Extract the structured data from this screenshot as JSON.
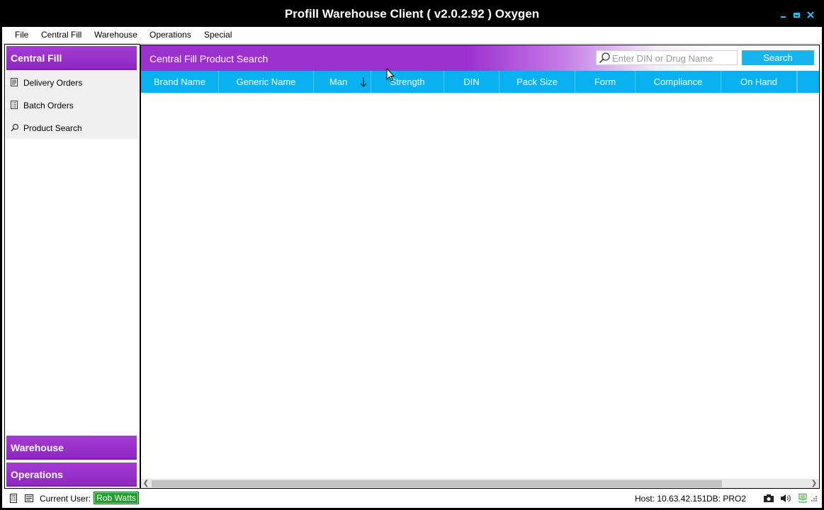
{
  "window": {
    "title": "Profill Warehouse Client ( v2.0.2.92 ) Oxygen",
    "controls": [
      "minimize-icon",
      "maximize-icon",
      "close-icon"
    ],
    "accent": "#1ec8ff"
  },
  "menubar": {
    "items": [
      "File",
      "Central Fill",
      "Warehouse",
      "Operations",
      "Special"
    ]
  },
  "sidebar": {
    "header": "Central Fill",
    "items": [
      {
        "label": "Delivery Orders",
        "icon": "document-icon"
      },
      {
        "label": "Batch Orders",
        "icon": "list-document-icon"
      },
      {
        "label": "Product Search",
        "icon": "search-icon"
      }
    ],
    "bottom_sections": [
      "Warehouse",
      "Operations"
    ],
    "section_color": "#9b30cf"
  },
  "main": {
    "title": "Central Fill Product Search",
    "search": {
      "placeholder": "Enter DIN or Drug Name",
      "value": "",
      "button": "Search"
    },
    "columns": [
      "Brand Name",
      "Generic Name",
      "Man",
      "Strength",
      "DIN",
      "Pack Size",
      "Form",
      "Compliance",
      "On Hand"
    ],
    "sorted_column": "Man",
    "sort_direction": "descending",
    "header_color": "#09b1f0",
    "rows": []
  },
  "statusbar": {
    "user_label": "Current User:",
    "user": "Rob Watts",
    "host": "Host: 10.63.42.151",
    "db": "DB: PRO2",
    "tray_icons": [
      "camera-icon",
      "speaker-icon",
      "network-icon"
    ]
  }
}
